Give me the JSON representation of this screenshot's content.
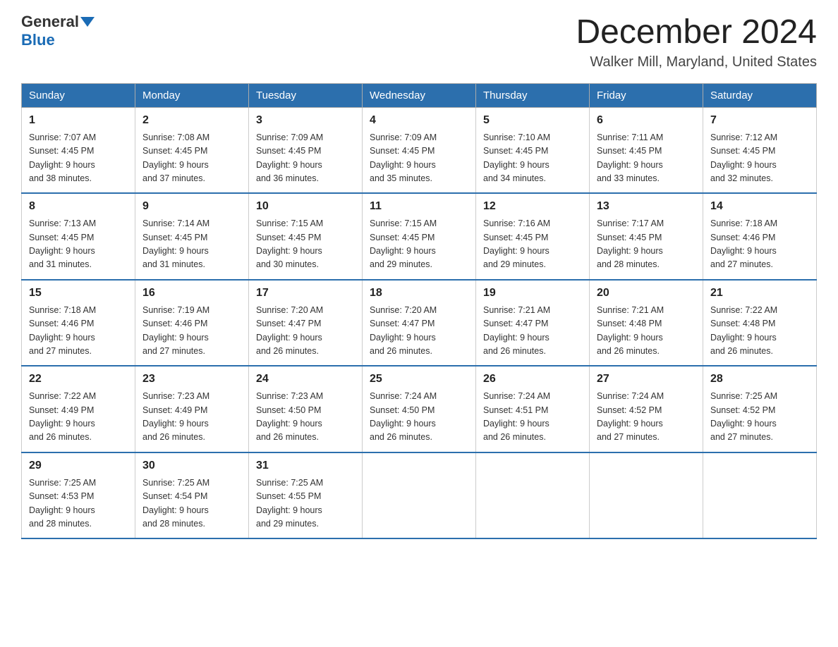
{
  "header": {
    "logo_general": "General",
    "logo_blue": "Blue",
    "month_title": "December 2024",
    "location": "Walker Mill, Maryland, United States"
  },
  "weekdays": [
    "Sunday",
    "Monday",
    "Tuesday",
    "Wednesday",
    "Thursday",
    "Friday",
    "Saturday"
  ],
  "weeks": [
    [
      {
        "day": "1",
        "sunrise": "7:07 AM",
        "sunset": "4:45 PM",
        "daylight": "9 hours and 38 minutes."
      },
      {
        "day": "2",
        "sunrise": "7:08 AM",
        "sunset": "4:45 PM",
        "daylight": "9 hours and 37 minutes."
      },
      {
        "day": "3",
        "sunrise": "7:09 AM",
        "sunset": "4:45 PM",
        "daylight": "9 hours and 36 minutes."
      },
      {
        "day": "4",
        "sunrise": "7:09 AM",
        "sunset": "4:45 PM",
        "daylight": "9 hours and 35 minutes."
      },
      {
        "day": "5",
        "sunrise": "7:10 AM",
        "sunset": "4:45 PM",
        "daylight": "9 hours and 34 minutes."
      },
      {
        "day": "6",
        "sunrise": "7:11 AM",
        "sunset": "4:45 PM",
        "daylight": "9 hours and 33 minutes."
      },
      {
        "day": "7",
        "sunrise": "7:12 AM",
        "sunset": "4:45 PM",
        "daylight": "9 hours and 32 minutes."
      }
    ],
    [
      {
        "day": "8",
        "sunrise": "7:13 AM",
        "sunset": "4:45 PM",
        "daylight": "9 hours and 31 minutes."
      },
      {
        "day": "9",
        "sunrise": "7:14 AM",
        "sunset": "4:45 PM",
        "daylight": "9 hours and 31 minutes."
      },
      {
        "day": "10",
        "sunrise": "7:15 AM",
        "sunset": "4:45 PM",
        "daylight": "9 hours and 30 minutes."
      },
      {
        "day": "11",
        "sunrise": "7:15 AM",
        "sunset": "4:45 PM",
        "daylight": "9 hours and 29 minutes."
      },
      {
        "day": "12",
        "sunrise": "7:16 AM",
        "sunset": "4:45 PM",
        "daylight": "9 hours and 29 minutes."
      },
      {
        "day": "13",
        "sunrise": "7:17 AM",
        "sunset": "4:45 PM",
        "daylight": "9 hours and 28 minutes."
      },
      {
        "day": "14",
        "sunrise": "7:18 AM",
        "sunset": "4:46 PM",
        "daylight": "9 hours and 27 minutes."
      }
    ],
    [
      {
        "day": "15",
        "sunrise": "7:18 AM",
        "sunset": "4:46 PM",
        "daylight": "9 hours and 27 minutes."
      },
      {
        "day": "16",
        "sunrise": "7:19 AM",
        "sunset": "4:46 PM",
        "daylight": "9 hours and 27 minutes."
      },
      {
        "day": "17",
        "sunrise": "7:20 AM",
        "sunset": "4:47 PM",
        "daylight": "9 hours and 26 minutes."
      },
      {
        "day": "18",
        "sunrise": "7:20 AM",
        "sunset": "4:47 PM",
        "daylight": "9 hours and 26 minutes."
      },
      {
        "day": "19",
        "sunrise": "7:21 AM",
        "sunset": "4:47 PM",
        "daylight": "9 hours and 26 minutes."
      },
      {
        "day": "20",
        "sunrise": "7:21 AM",
        "sunset": "4:48 PM",
        "daylight": "9 hours and 26 minutes."
      },
      {
        "day": "21",
        "sunrise": "7:22 AM",
        "sunset": "4:48 PM",
        "daylight": "9 hours and 26 minutes."
      }
    ],
    [
      {
        "day": "22",
        "sunrise": "7:22 AM",
        "sunset": "4:49 PM",
        "daylight": "9 hours and 26 minutes."
      },
      {
        "day": "23",
        "sunrise": "7:23 AM",
        "sunset": "4:49 PM",
        "daylight": "9 hours and 26 minutes."
      },
      {
        "day": "24",
        "sunrise": "7:23 AM",
        "sunset": "4:50 PM",
        "daylight": "9 hours and 26 minutes."
      },
      {
        "day": "25",
        "sunrise": "7:24 AM",
        "sunset": "4:50 PM",
        "daylight": "9 hours and 26 minutes."
      },
      {
        "day": "26",
        "sunrise": "7:24 AM",
        "sunset": "4:51 PM",
        "daylight": "9 hours and 26 minutes."
      },
      {
        "day": "27",
        "sunrise": "7:24 AM",
        "sunset": "4:52 PM",
        "daylight": "9 hours and 27 minutes."
      },
      {
        "day": "28",
        "sunrise": "7:25 AM",
        "sunset": "4:52 PM",
        "daylight": "9 hours and 27 minutes."
      }
    ],
    [
      {
        "day": "29",
        "sunrise": "7:25 AM",
        "sunset": "4:53 PM",
        "daylight": "9 hours and 28 minutes."
      },
      {
        "day": "30",
        "sunrise": "7:25 AM",
        "sunset": "4:54 PM",
        "daylight": "9 hours and 28 minutes."
      },
      {
        "day": "31",
        "sunrise": "7:25 AM",
        "sunset": "4:55 PM",
        "daylight": "9 hours and 29 minutes."
      },
      null,
      null,
      null,
      null
    ]
  ]
}
